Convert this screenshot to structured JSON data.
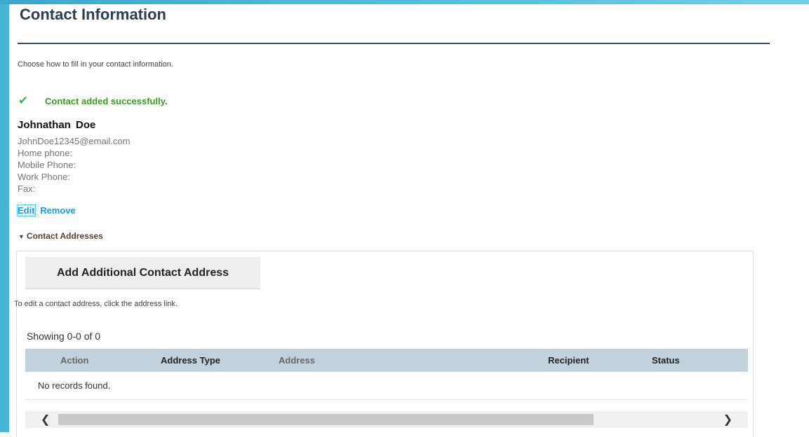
{
  "page": {
    "title": "Contact Information",
    "intro": "Choose how to fill in your contact information.",
    "success_message": "Contact added successfully."
  },
  "contact": {
    "name": "Johnathan  Doe",
    "email": "JohnDoe12345@email.com",
    "home_phone": "Home phone:",
    "mobile_phone": "Mobile Phone:",
    "work_phone": "Work Phone:",
    "fax": "Fax:",
    "edit_label": "Edit",
    "remove_label": "Remove"
  },
  "addresses": {
    "section_label": "Contact Addresses",
    "add_button": "Add Additional Contact Address",
    "hint": "To edit a contact address, click the address link.",
    "showing": "Showing 0-0 of 0",
    "columns": [
      "Action",
      "Address Type",
      "Address",
      "Recipient",
      "Status"
    ],
    "empty_message": "No records found."
  },
  "colors": {
    "frame": "#45b4d6",
    "success": "#3a9a1e",
    "link": "#1a9ae0",
    "table_header": "#c2d2dc"
  },
  "icons": [
    "checkmark-icon",
    "triangle-down-icon",
    "chevron-left-icon",
    "chevron-right-icon"
  ]
}
